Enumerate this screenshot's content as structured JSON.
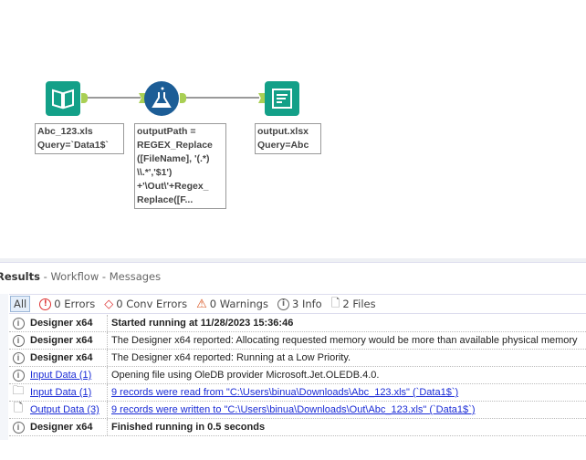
{
  "workflow": {
    "nodes": [
      {
        "name": "Input Data",
        "label": "Abc_123.xls\nQuery=`Data1$`"
      },
      {
        "name": "Formula",
        "label": "outputPath =\nREGEX_Replace\n([FileName], '(.*)\n\\\\.*','$1')\n+'\\Out\\'+Regex_\nReplace([F..."
      },
      {
        "name": "Output Data",
        "label": "output.xlsx\nQuery=Abc"
      }
    ]
  },
  "results": {
    "title": "Results",
    "sep1": " - Workflow - ",
    "sub": "Messages",
    "filters": {
      "all": "All",
      "errors": "0 Errors",
      "conv": "0 Conv Errors",
      "warnings": "0 Warnings",
      "info": "3 Info",
      "files": "2 Files"
    },
    "rows": [
      {
        "icon": "info",
        "source": "Designer x64",
        "message": "Started running at 11/28/2023 15:36:46",
        "bold": true,
        "link": false
      },
      {
        "icon": "info",
        "source": "Designer x64",
        "message": "The Designer x64 reported: Allocating requested memory would be more than available physical memory",
        "bold": false,
        "link": false
      },
      {
        "icon": "info",
        "source": "Designer x64",
        "message": "The Designer x64 reported: Running at a Low Priority.",
        "bold": false,
        "link": false
      },
      {
        "icon": "info",
        "source": "Input Data (1)",
        "message": "Opening file using OleDB provider Microsoft.Jet.OLEDB.4.0.",
        "bold": false,
        "link": false,
        "sourceLink": true
      },
      {
        "icon": "folder",
        "source": "Input Data (1)",
        "message": "9 records were read from \"C:\\Users\\binua\\Downloads\\Abc_123.xls\" (`Data1$`)",
        "bold": false,
        "link": true,
        "sourceLink": true
      },
      {
        "icon": "file",
        "source": "Output Data (3)",
        "message": "9 records were written to \"C:\\Users\\binua\\Downloads\\Out\\Abc_123.xls\" (`Data1$`)",
        "bold": false,
        "link": true,
        "sourceLink": true
      },
      {
        "icon": "info",
        "source": "Designer x64",
        "message": "Finished running in 0.5 seconds",
        "bold": true,
        "link": false
      }
    ]
  }
}
